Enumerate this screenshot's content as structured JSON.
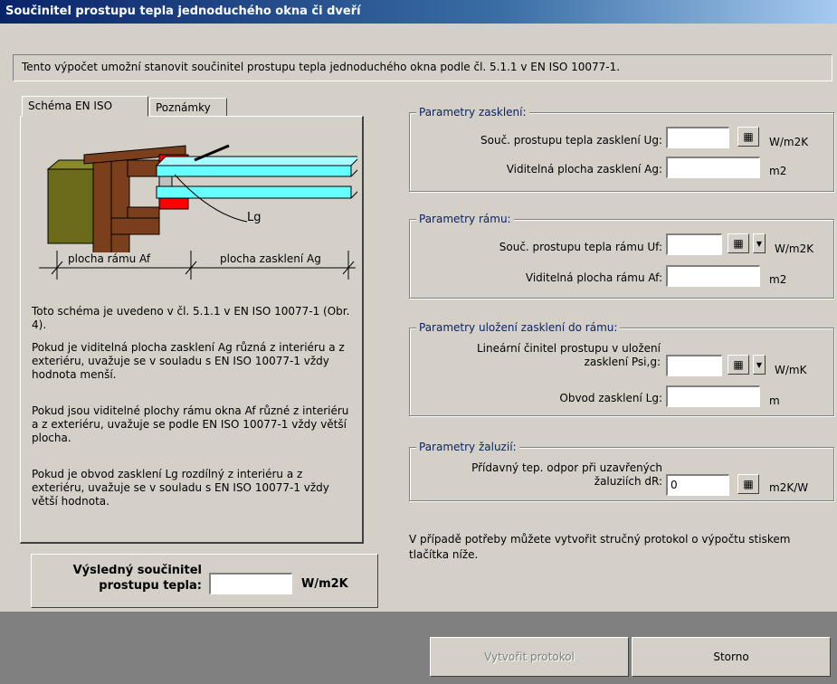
{
  "window": {
    "title": "Součinitel prostupu tepla jednoduchého okna či dveří"
  },
  "info": {
    "text": "Tento výpočet umožní stanovit součinitel prostupu tepla jednoduchého okna podle čl. 5.1.1 v EN ISO 10077-1."
  },
  "tabs": [
    {
      "label": "Schéma EN ISO"
    },
    {
      "label": "Poznámky"
    }
  ],
  "schema": {
    "lg_label": "Lg",
    "frame_area_label": "plocha rámu Af",
    "glazing_area_label": "plocha zasklení Ag",
    "notes": [
      "Toto schéma je uvedeno v čl. 5.1.1 v EN ISO 10077-1 (Obr. 4).",
      "Pokud je viditelná plocha zasklení Ag různá z interiéru a z exteriéru, uvažuje se v souladu s EN ISO 10077-1 vždy hodnota menší.",
      "Pokud jsou viditelné plochy rámu okna Af různé z interiéru a z exteriéru, uvažuje se podle EN ISO 10077-1 vždy větší plocha.",
      "Pokud je obvod zasklení Lg rozdílný z interiéru a z exteriéru, uvažuje se v souladu s EN ISO 10077-1 vždy větší hodnota."
    ]
  },
  "result": {
    "label": "Výsledný součinitel prostupu tepla:",
    "value": "",
    "unit": "W/m2K"
  },
  "groups": {
    "glazing": {
      "title": "Parametry zasklení:",
      "ug_label": "Souč. prostupu tepla zasklení Ug:",
      "ug_value": "",
      "ug_unit": "W/m2K",
      "ag_label": "Viditelná plocha zasklení Ag:",
      "ag_value": "",
      "ag_unit": "m2"
    },
    "frame": {
      "title": "Parametry rámu:",
      "uf_label": "Souč. prostupu tepla rámu Uf:",
      "uf_value": "",
      "uf_unit": "W/m2K",
      "af_label": "Viditelná plocha rámu Af:",
      "af_value": "",
      "af_unit": "m2"
    },
    "mounting": {
      "title": "Parametry uložení zasklení do rámu:",
      "psi_label": "Lineární činitel prostupu v uložení zasklení Psi,g:",
      "psi_value": "",
      "psi_unit": "W/mK",
      "lg_label": "Obvod zasklení Lg:",
      "lg_value": "",
      "lg_unit": "m"
    },
    "shutters": {
      "title": "Parametry žaluzií:",
      "dr_label": "Přídavný tep. odpor při uzavřených žaluziích dR:",
      "dr_value": "0",
      "dr_unit": "m2K/W"
    }
  },
  "protocol_note": "V případě potřeby můžete vytvořit stručný protokol o výpočtu stiskem tlačítka níže.",
  "buttons": {
    "create_protocol": "Vytvořit protokol",
    "cancel": "Storno"
  },
  "icons": {
    "calculator": "calculator-icon",
    "dropdown": "chevron-down-icon"
  },
  "colors": {
    "title_start": "#0a246a",
    "title_end": "#a6caf0",
    "glass": "#66ffff",
    "frame_brown": "#7b3f1d",
    "olive": "#6b6b1a",
    "seal_red": "#ff0000"
  }
}
